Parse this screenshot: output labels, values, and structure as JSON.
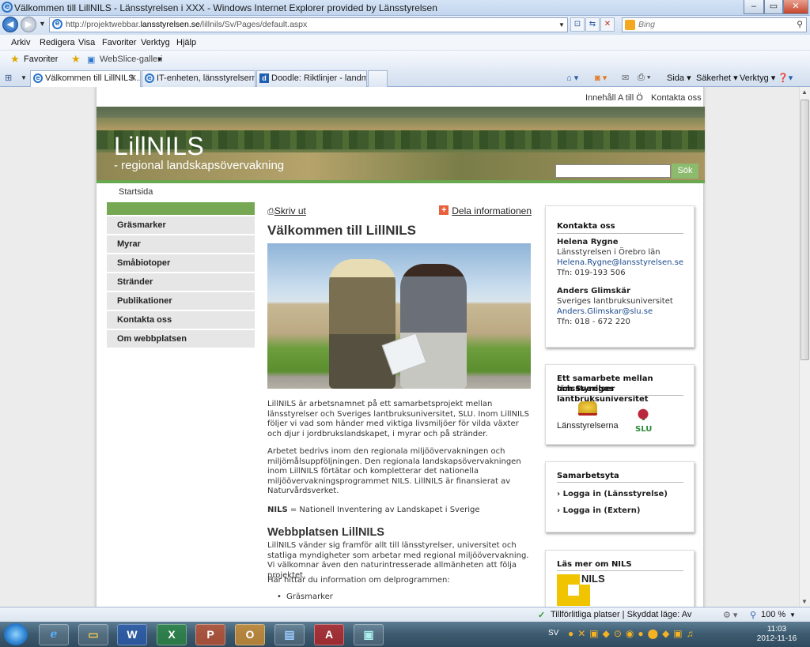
{
  "window": {
    "title": "Välkommen till LillNILS - Länsstyrelsen i XXX - Windows Internet Explorer provided by Länsstyrelsen"
  },
  "address": {
    "url_prefix": "http://projektwebbar.",
    "url_domain": "lansstyrelsen.se",
    "url_rest": "/lillnils/Sv/Pages/default.aspx",
    "search_placeholder": "Bing"
  },
  "menu": [
    "Arkiv",
    "Redigera",
    "Visa",
    "Favoriter",
    "Verktyg",
    "Hjälp"
  ],
  "favorites": {
    "label": "Favoriter",
    "webslice": "WebSlice-galleri"
  },
  "tabs": [
    {
      "label": "Välkommen till LillNILS..."
    },
    {
      "label": "IT-enheten, länsstyrelserna..."
    },
    {
      "label": "Doodle: Riktlinjer - landmil..."
    }
  ],
  "commands": {
    "page": "Sida",
    "safety": "Säkerhet",
    "tools": "Verktyg"
  },
  "site": {
    "toplinks": {
      "az": "Innehåll A till Ö",
      "contact": "Kontakta oss"
    },
    "logo_title": "LillNILS",
    "logo_subtitle": "- regional landskapsövervakning",
    "search_button": "Sök",
    "breadcrumb": "Startsida",
    "nav": [
      "Gräsmarker",
      "Myrar",
      "Småbiotoper",
      "Stränder",
      "Publikationer",
      "Kontakta oss",
      "Om webbplatsen"
    ]
  },
  "main": {
    "print_label": "Skriv ut",
    "share_label": "Dela informationen",
    "heading": "Välkommen till LillNILS",
    "para1": "LillNILS är arbetsnamnet på ett samarbetsprojekt mellan länsstyrelser och Sveriges lantbruksuniversitet, SLU. Inom LillNILS följer vi vad som händer med viktiga livsmiljöer för vilda växter och djur i jordbrukslandskapet, i myrar och på stränder.",
    "para2": "Arbetet bedrivs inom den regionala miljöövervakningen och miljömålsuppföljningen. Den regionala landskapsövervakningen inom LillNILS förtätar och kompletterar det nationella miljöövervakningsprogrammet NILS. LillNILS är finansierat av Naturvårdsverket.",
    "nils_abbr": "NILS",
    "nils_def": " = Nationell Inventering av Landskapet i Sverige",
    "heading2": "Webbplatsen LillNILS",
    "para3": "LillNILS vänder sig framför allt till länsstyrelser, universitet och statliga myndigheter som arbetar med regional miljöövervakning. Vi välkomnar även den naturintresserade allmänheten att följa projektet.",
    "para4": "Här hittar du information om delprogrammen:",
    "bullet1": "Gräsmarker"
  },
  "contact_box": {
    "title": "Kontakta oss",
    "person1": {
      "name": "Helena Rygne",
      "org": "Länsstyrelsen i Örebro län",
      "email": "Helena.Rygne@lansstyrelsen.se",
      "phone": "Tfn: 019-193 506"
    },
    "person2": {
      "name": "Anders Glimskär",
      "org": "Sveriges lantbruksuniversitet",
      "email": "Anders.Glimskar@slu.se",
      "phone": "Tfn: 018 - 672 220"
    }
  },
  "collab_box": {
    "title_line1": "Ett samarbete mellan länsstyrelser",
    "title_line2": "och Sveriges lantbruksuniversitet",
    "logo1": "Länsstyrelserna",
    "logo2": "SLU"
  },
  "workspace_box": {
    "title": "Samarbetsyta",
    "link1": "Logga in (Länsstyrelse)",
    "link2": "Logga in (Extern)"
  },
  "nils_box": {
    "title": "Läs mer om NILS",
    "logo_text": "NILS"
  },
  "status": {
    "trusted": "Tillförlitliga platser | Skyddat läge: Av",
    "zoom": "100 %"
  },
  "taskbar": {
    "lang": "SV",
    "time": "11:03",
    "date": "2012-11-16"
  },
  "colors": {
    "nav_green": "#76a854",
    "link_blue": "#1a4a8c",
    "share_orange": "#e8603c"
  }
}
